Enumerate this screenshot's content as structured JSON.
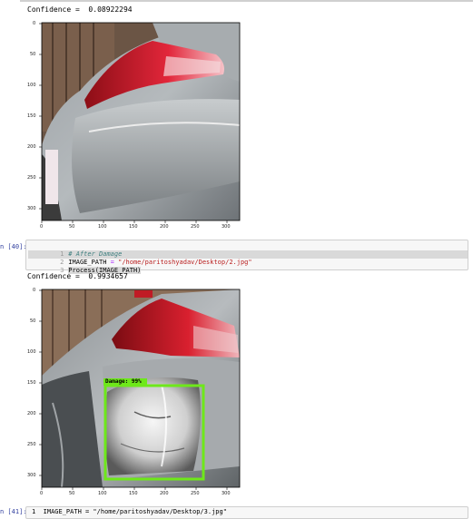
{
  "top_border_visible": true,
  "output1": {
    "confidence_line": "Confidence =  0.08922294"
  },
  "plot1": {
    "y_ticks": [
      "0",
      "50",
      "100",
      "150",
      "200",
      "250",
      "300"
    ],
    "x_ticks": [
      "0",
      "50",
      "100",
      "150",
      "200",
      "250",
      "300"
    ],
    "image_subject": "gray-car-rear-no-damage"
  },
  "cell40": {
    "prompt": "n [40]:",
    "lines": [
      {
        "num": "1",
        "comment": "# After Damage"
      },
      {
        "num": "2",
        "var": "IMAGE_PATH",
        "op": " = ",
        "string": "\"/home/paritoshyadav/Desktop/2.jpg\""
      },
      {
        "num": "3",
        "code": "Process(IMAGE_PATH)"
      }
    ]
  },
  "output2": {
    "confidence_line": "Confidence =  0.9934657"
  },
  "plot2": {
    "y_ticks": [
      "0",
      "50",
      "100",
      "150",
      "200",
      "250",
      "300"
    ],
    "x_ticks": [
      "0",
      "50",
      "100",
      "150",
      "200",
      "250",
      "300"
    ],
    "image_subject": "gray-car-rear-dented",
    "detection": {
      "label": "Damage: 99%",
      "box_color": "#6ee81a"
    }
  },
  "cell41": {
    "prompt": "n [41]:",
    "partial_text": "1  IMAGE_PATH = \"/home/paritoshyadav/Desktop/3.jpg\""
  },
  "colors": {
    "prompt": "#303f9f",
    "string": "#ba2121",
    "comment": "#408080",
    "box": "#6ee81a"
  }
}
